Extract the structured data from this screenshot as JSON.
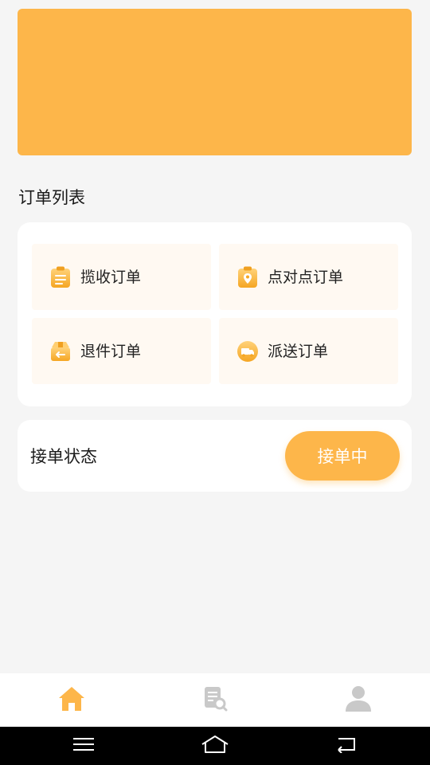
{
  "banner": {
    "color": "#fdb64a"
  },
  "orders": {
    "title": "订单列表",
    "items": [
      {
        "label": "揽收订单",
        "icon": "clipboard-icon"
      },
      {
        "label": "点对点订单",
        "icon": "location-pin-icon"
      },
      {
        "label": "退件订单",
        "icon": "return-box-icon"
      },
      {
        "label": "派送订单",
        "icon": "delivery-truck-icon"
      }
    ]
  },
  "status": {
    "label": "接单状态",
    "button_label": "接单中"
  },
  "tabbar": {
    "items": [
      {
        "icon": "home-icon",
        "active": true
      },
      {
        "icon": "order-search-icon",
        "active": false
      },
      {
        "icon": "user-icon",
        "active": false
      }
    ]
  },
  "colors": {
    "accent": "#fdb64a",
    "inactive": "#c9c9c9",
    "tile_bg": "#fff9f2"
  },
  "system_nav": {
    "items": [
      "menu-icon",
      "home-outline-icon",
      "back-icon"
    ]
  }
}
